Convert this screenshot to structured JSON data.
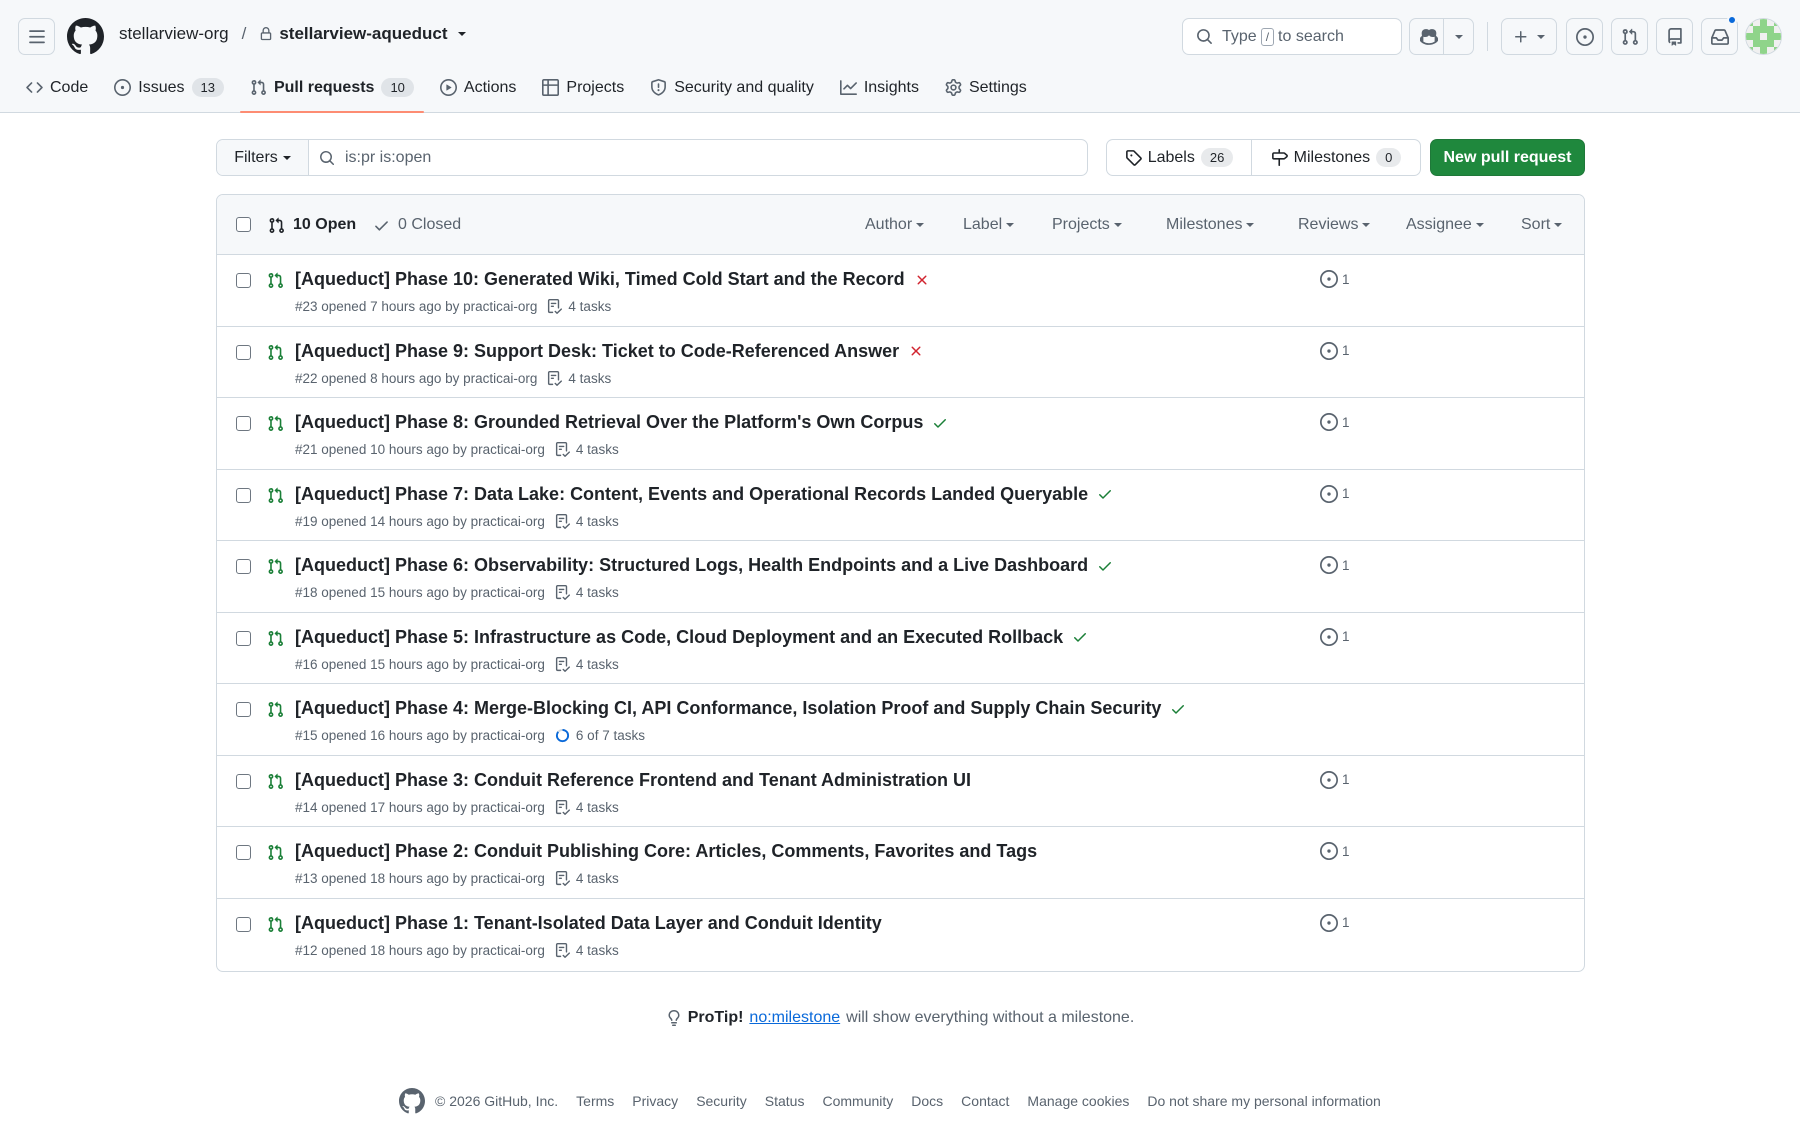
{
  "header": {
    "org": "stellarview-org",
    "separator": "/",
    "repo": "stellarview-aqueduct",
    "search_prefix": "Type",
    "search_key": "/",
    "search_suffix": "to search"
  },
  "tabs": [
    {
      "label": "Code"
    },
    {
      "label": "Issues",
      "count": "13"
    },
    {
      "label": "Pull requests",
      "count": "10"
    },
    {
      "label": "Actions"
    },
    {
      "label": "Projects"
    },
    {
      "label": "Security and quality"
    },
    {
      "label": "Insights"
    },
    {
      "label": "Settings"
    }
  ],
  "toolbar": {
    "filters_label": "Filters",
    "query": "is:pr is:open",
    "labels_label": "Labels",
    "labels_count": "26",
    "milestones_label": "Milestones",
    "milestones_count": "0",
    "new_pr_label": "New pull request"
  },
  "list_header": {
    "open_label": "10 Open",
    "closed_label": "0 Closed",
    "filters": [
      "Author",
      "Label",
      "Projects",
      "Milestones",
      "Reviews",
      "Assignee",
      "Sort"
    ]
  },
  "pull_requests": [
    {
      "title": "[Aqueduct] Phase 10: Generated Wiki, Timed Cold Start and the Record",
      "status": "fail",
      "meta": "#23 opened 7 hours ago by practicai-org",
      "tasks": "4 tasks",
      "comments": "1"
    },
    {
      "title": "[Aqueduct] Phase 9: Support Desk: Ticket to Code-Referenced Answer",
      "status": "fail",
      "meta": "#22 opened 8 hours ago by practicai-org",
      "tasks": "4 tasks",
      "comments": "1"
    },
    {
      "title": "[Aqueduct] Phase 8: Grounded Retrieval Over the Platform's Own Corpus",
      "status": "pass",
      "meta": "#21 opened 10 hours ago by practicai-org",
      "tasks": "4 tasks",
      "comments": "1"
    },
    {
      "title": "[Aqueduct] Phase 7: Data Lake: Content, Events and Operational Records Landed Queryable",
      "status": "pass",
      "meta": "#19 opened 14 hours ago by practicai-org",
      "tasks": "4 tasks",
      "comments": "1"
    },
    {
      "title": "[Aqueduct] Phase 6: Observability: Structured Logs, Health Endpoints and a Live Dashboard",
      "status": "pass",
      "meta": "#18 opened 15 hours ago by practicai-org",
      "tasks": "4 tasks",
      "comments": "1"
    },
    {
      "title": "[Aqueduct] Phase 5: Infrastructure as Code, Cloud Deployment and an Executed Rollback",
      "status": "pass",
      "meta": "#16 opened 15 hours ago by practicai-org",
      "tasks": "4 tasks",
      "comments": "1"
    },
    {
      "title": "[Aqueduct] Phase 4: Merge-Blocking CI, API Conformance, Isolation Proof and Supply Chain Security",
      "status": "pass",
      "meta": "#15 opened 16 hours ago by practicai-org",
      "tasks": "6 of 7 tasks",
      "progress": 0.857,
      "comments": ""
    },
    {
      "title": "[Aqueduct] Phase 3: Conduit Reference Frontend and Tenant Administration UI",
      "status": "none",
      "meta": "#14 opened 17 hours ago by practicai-org",
      "tasks": "4 tasks",
      "comments": "1"
    },
    {
      "title": "[Aqueduct] Phase 2: Conduit Publishing Core: Articles, Comments, Favorites and Tags",
      "status": "none",
      "meta": "#13 opened 18 hours ago by practicai-org",
      "tasks": "4 tasks",
      "comments": "1"
    },
    {
      "title": "[Aqueduct] Phase 1: Tenant-Isolated Data Layer and Conduit Identity",
      "status": "none",
      "meta": "#12 opened 18 hours ago by practicai-org",
      "tasks": "4 tasks",
      "comments": "1"
    }
  ],
  "protip": {
    "lead": "ProTip!",
    "link": "no:milestone",
    "rest": "will show everything without a milestone."
  },
  "footer": {
    "copyright": "© 2026 GitHub, Inc.",
    "links": [
      "Terms",
      "Privacy",
      "Security",
      "Status",
      "Community",
      "Docs",
      "Contact",
      "Manage cookies",
      "Do not share my personal information"
    ]
  },
  "colors": {
    "accent": "#1f883d",
    "fail": "#d1242f",
    "pass": "#1a7f37",
    "link": "#0969da",
    "tab_underline": "#fd8c73"
  }
}
